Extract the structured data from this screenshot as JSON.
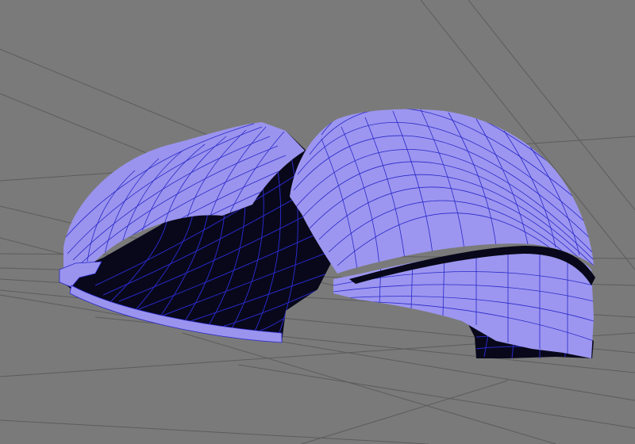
{
  "viewport": {
    "background_color": "#7a7a7a",
    "grid_color": "#5c5c5c",
    "grid": true
  },
  "scene": {
    "objects": [
      {
        "id": "left-shell",
        "fill_color": "#9a94ee",
        "inner_color": "#08081a",
        "wire_color": "#2a28c8"
      },
      {
        "id": "right-shell",
        "fill_color": "#9c96f0",
        "inner_color": "#08081a",
        "wire_color": "#2a28c8"
      }
    ]
  }
}
